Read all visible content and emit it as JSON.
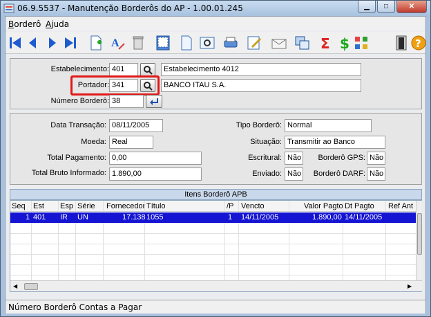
{
  "window": {
    "title": "06.9.5537 - Manutenção Borderôs do AP - 1.00.01.245",
    "bg_title": "Contas a Pagar"
  },
  "menu": [
    {
      "label": "Borderô"
    },
    {
      "label": "Ajuda"
    }
  ],
  "toolbar": [
    {
      "icon": "first-record-icon"
    },
    {
      "icon": "previous-record-icon"
    },
    {
      "icon": "next-record-icon"
    },
    {
      "icon": "last-record-icon"
    },
    {
      "icon": "new-document-icon"
    },
    {
      "icon": "edit-text-icon"
    },
    {
      "icon": "delete-bin-icon"
    },
    {
      "icon": "calculator-icon"
    },
    {
      "icon": "blank-page-icon"
    },
    {
      "icon": "print-preview-icon"
    },
    {
      "icon": "printer-icon"
    },
    {
      "icon": "edit-document-icon"
    },
    {
      "icon": "mail-envelope-icon"
    },
    {
      "icon": "copy-windows-icon"
    },
    {
      "icon": "sum-sigma-icon"
    },
    {
      "icon": "money-dollar-icon"
    },
    {
      "icon": "colored-grid-icon"
    },
    {
      "icon": "exit-door-icon"
    },
    {
      "icon": "help-question-icon"
    }
  ],
  "header": {
    "estabelecimento_label": "Estabelecimento:",
    "estabelecimento_code": "401",
    "estabelecimento_name": "Estabelecimento 4012",
    "portador_label": "Portador:",
    "portador_code": "341",
    "portador_name": "BANCO ITAU S.A.",
    "numero_label": "Número Borderô:",
    "numero_value": "38"
  },
  "details": {
    "data_transacao_label": "Data Transação:",
    "data_transacao": "08/11/2005",
    "moeda_label": "Moeda:",
    "moeda": "Real",
    "total_pagamento_label": "Total Pagamento:",
    "total_pagamento": "0,00",
    "total_bruto_label": "Total Bruto Informado:",
    "total_bruto": "1.890,00",
    "tipo_bordero_label": "Tipo Borderô:",
    "tipo_bordero": "Normal",
    "situacao_label": "Situação:",
    "situacao": "Transmitir ao Banco",
    "escritural_label": "Escritural:",
    "escritural": "Não",
    "enviado_label": "Enviado:",
    "enviado": "Não",
    "bordero_gps_label": "Borderô GPS:",
    "bordero_gps": "Não",
    "bordero_darf_label": "Borderô DARF:",
    "bordero_darf": "Não"
  },
  "grid": {
    "title": "Itens Borderô APB",
    "columns": [
      "Seq",
      "Est",
      "Esp",
      "Série",
      "Fornecedor",
      "Título",
      "/P",
      "Vencto",
      "Valor Pagto",
      "Dt Pagto",
      "Ref Ant"
    ],
    "rows": [
      [
        "1",
        "401",
        "IR",
        "UN",
        "17.138",
        "1055",
        "1",
        "14/11/2005",
        "1.890,00",
        "14/11/2005",
        ""
      ]
    ]
  },
  "status": {
    "text": "Número Borderô Contas a Pagar"
  },
  "colors": {
    "selection": "#1414d2",
    "highlight": "#e01818",
    "title_bar": "#a7c1de"
  }
}
